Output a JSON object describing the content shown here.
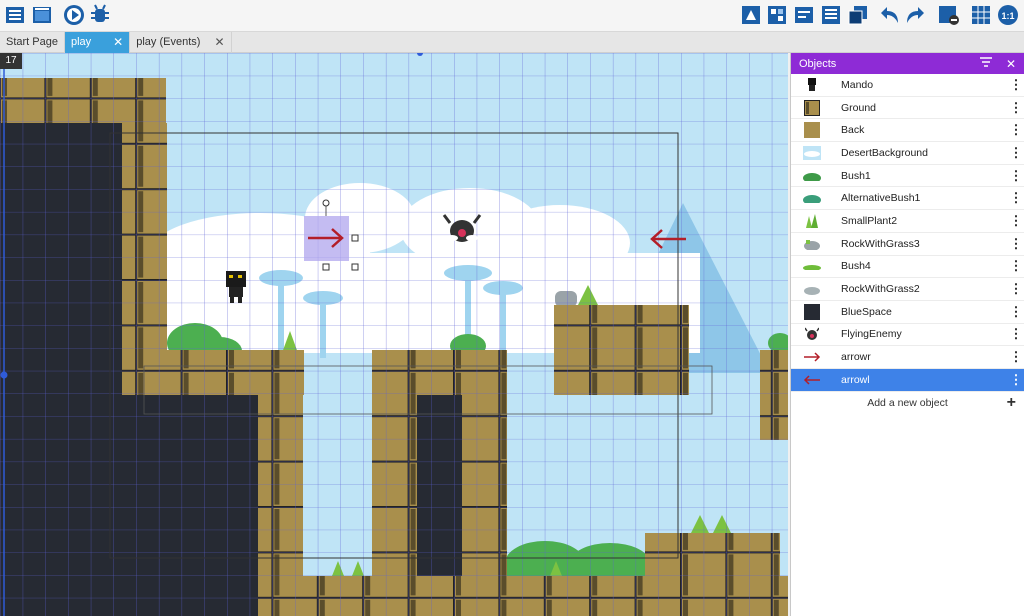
{
  "toolbar": {
    "left_icons": [
      "project-manager-icon",
      "scene-editor-icon",
      "preview-play-icon",
      "debugger-icon"
    ],
    "right_icons": [
      "objects-panel-icon",
      "object-groups-icon",
      "properties-panel-icon",
      "instances-list-icon",
      "layers-icon",
      "undo-icon",
      "redo-icon",
      "grid-toggle-icon",
      "grid-icon",
      "zoom-reset-icon"
    ]
  },
  "tabs": [
    {
      "label": "Start Page",
      "closable": false,
      "active": false
    },
    {
      "label": "play",
      "closable": true,
      "active": true
    },
    {
      "label": "play (Events)",
      "closable": true,
      "active": false
    }
  ],
  "scene": {
    "zoom_badge": "17",
    "colors": {
      "sky": "#bfe4f6",
      "block": "#a98f4c",
      "dark": "#262a33",
      "grid": "#5b5fd6",
      "bush": "#4caf50"
    }
  },
  "panel": {
    "title": "Objects",
    "objects": [
      {
        "name": "Mando",
        "icon": "mando-icon"
      },
      {
        "name": "Ground",
        "icon": "ground-icon"
      },
      {
        "name": "Back",
        "icon": "back-icon"
      },
      {
        "name": "DesertBackground",
        "icon": "desert-background-icon"
      },
      {
        "name": "Bush1",
        "icon": "bush-icon"
      },
      {
        "name": "AlternativeBush1",
        "icon": "alt-bush-icon"
      },
      {
        "name": "SmallPlant2",
        "icon": "small-plant-icon"
      },
      {
        "name": "RockWithGrass3",
        "icon": "rock-grass-icon"
      },
      {
        "name": "Bush4",
        "icon": "bush4-icon"
      },
      {
        "name": "RockWithGrass2",
        "icon": "rock-grass2-icon"
      },
      {
        "name": "BlueSpace",
        "icon": "bluespace-icon"
      },
      {
        "name": "FlyingEnemy",
        "icon": "flying-enemy-icon"
      },
      {
        "name": "arrowr",
        "icon": "arrow-right-icon"
      },
      {
        "name": "arrowl",
        "icon": "arrow-left-icon",
        "selected": true
      }
    ],
    "add_label": "Add a new object"
  }
}
